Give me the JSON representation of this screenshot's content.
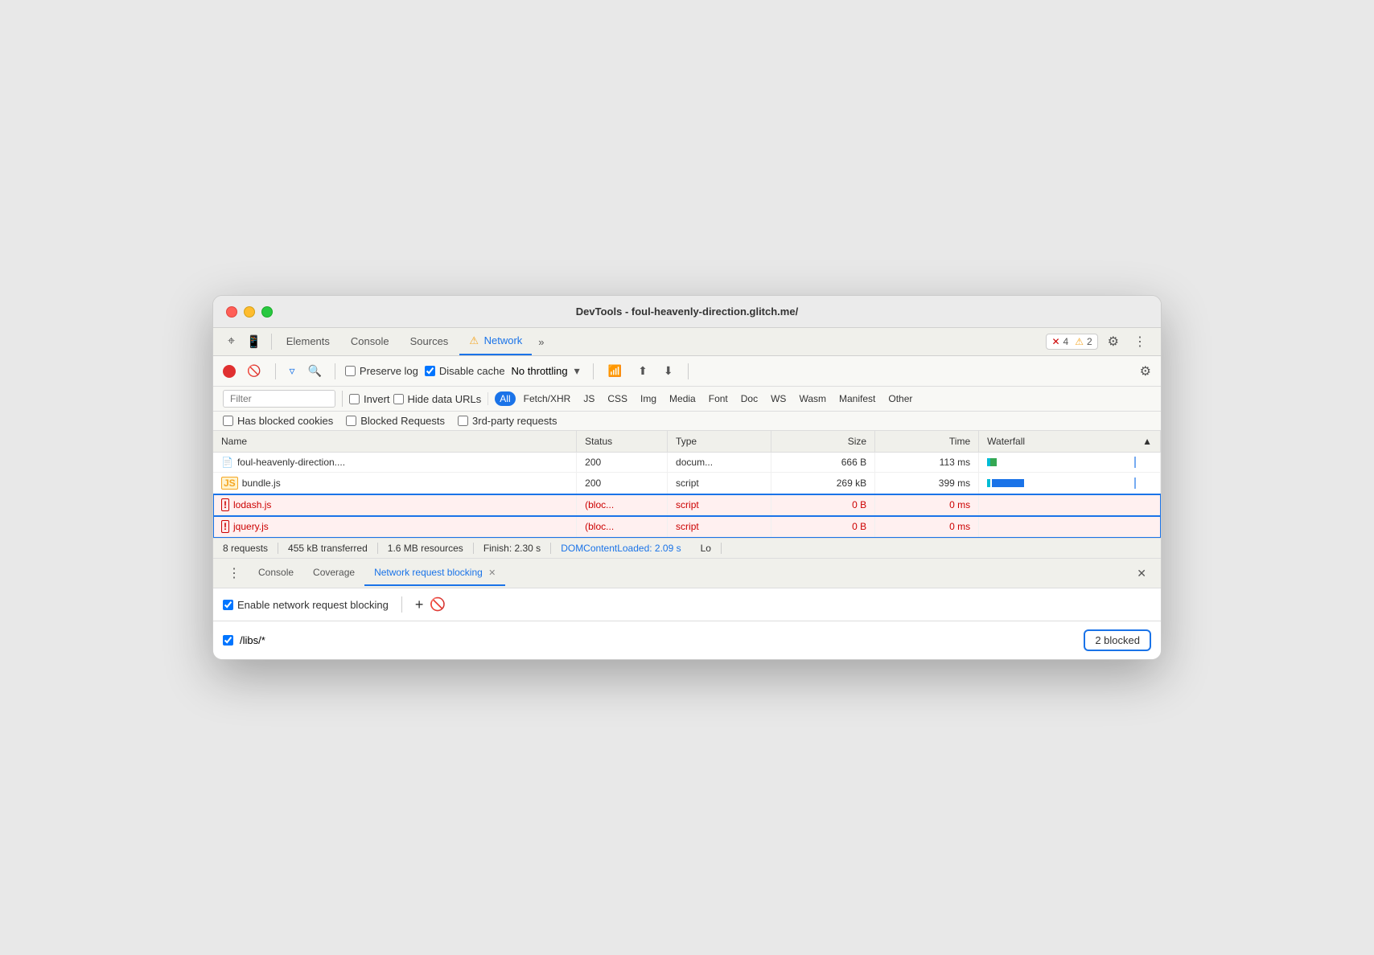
{
  "window": {
    "title": "DevTools - foul-heavenly-direction.glitch.me/"
  },
  "tabs": {
    "items": [
      {
        "label": "Elements",
        "active": false
      },
      {
        "label": "Console",
        "active": false
      },
      {
        "label": "Sources",
        "active": false
      },
      {
        "label": "Network",
        "active": true,
        "warning": true
      },
      {
        "label": "»",
        "active": false
      }
    ],
    "errors": "4",
    "warnings": "2"
  },
  "toolbar": {
    "preserve_log": "Preserve log",
    "disable_cache": "Disable cache",
    "no_throttling": "No throttling",
    "filter_placeholder": "Filter"
  },
  "filter_types": [
    "All",
    "Fetch/XHR",
    "JS",
    "CSS",
    "Img",
    "Media",
    "Font",
    "Doc",
    "WS",
    "Wasm",
    "Manifest",
    "Other"
  ],
  "checkboxes": {
    "invert": "Invert",
    "hide_data_urls": "Hide data URLs",
    "has_blocked_cookies": "Has blocked cookies",
    "blocked_requests": "Blocked Requests",
    "third_party": "3rd-party requests"
  },
  "table": {
    "headers": [
      "Name",
      "Status",
      "Type",
      "Size",
      "Time",
      "Waterfall"
    ],
    "rows": [
      {
        "name": "foul-heavenly-direction....",
        "status": "200",
        "type": "docum...",
        "size": "666 B",
        "time": "113 ms",
        "waterfall": "doc",
        "blocked": false,
        "icon": "doc"
      },
      {
        "name": "bundle.js",
        "status": "200",
        "type": "script",
        "size": "269 kB",
        "time": "399 ms",
        "waterfall": "script",
        "blocked": false,
        "icon": "js"
      },
      {
        "name": "lodash.js",
        "status": "(bloc...",
        "type": "script",
        "size": "0 B",
        "time": "0 ms",
        "waterfall": "",
        "blocked": true,
        "icon": "blocked"
      },
      {
        "name": "jquery.js",
        "status": "(bloc...",
        "type": "script",
        "size": "0 B",
        "time": "0 ms",
        "waterfall": "",
        "blocked": true,
        "icon": "blocked"
      }
    ]
  },
  "status_bar": {
    "requests": "8 requests",
    "transferred": "455 kB transferred",
    "resources": "1.6 MB resources",
    "finish": "Finish: 2.30 s",
    "domcl": "DOMContentLoaded: 2.09 s",
    "load": "Lo"
  },
  "bottom_panel": {
    "tabs": [
      {
        "label": "Console",
        "active": false
      },
      {
        "label": "Coverage",
        "active": false
      },
      {
        "label": "Network request blocking",
        "active": true,
        "closeable": true
      }
    ],
    "enable_label": "Enable network request blocking",
    "blocking_pattern": "/libs/*",
    "blocked_count": "2 blocked"
  }
}
